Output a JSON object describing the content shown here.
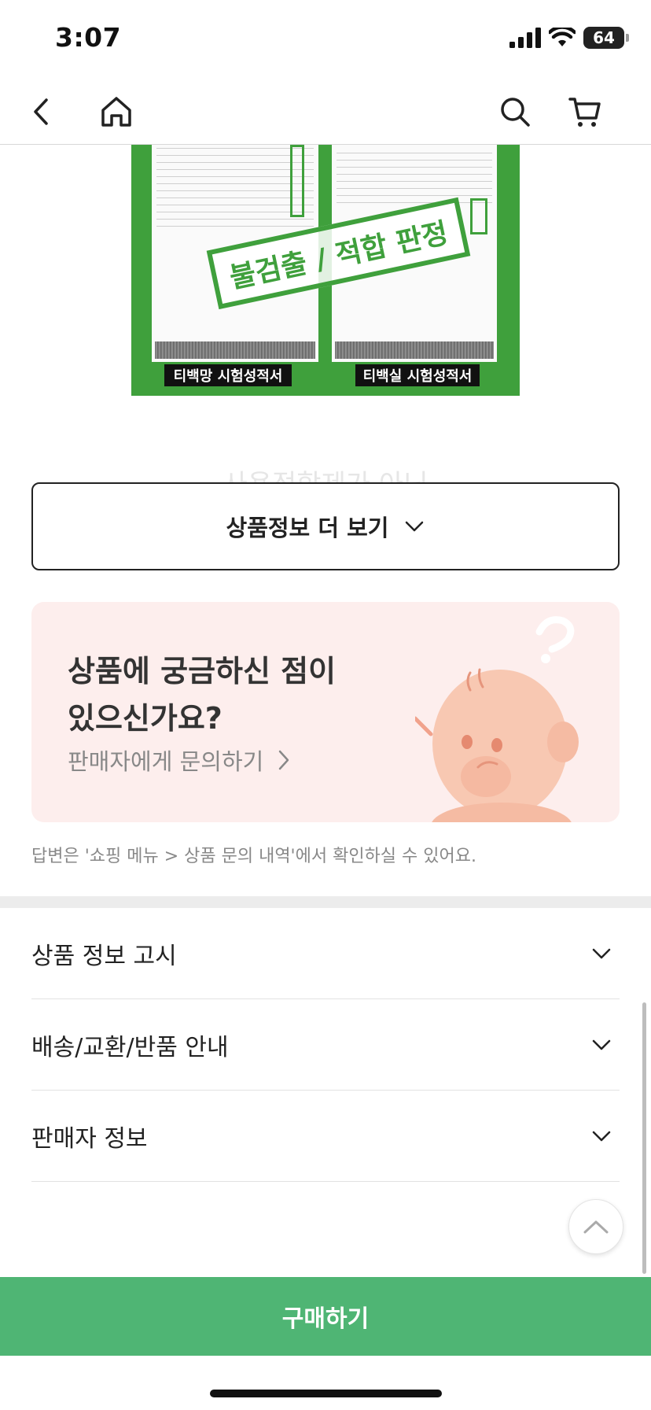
{
  "status_bar": {
    "time": "3:07",
    "battery": "64"
  },
  "nav": {
    "back_icon": "back-icon",
    "home_icon": "home-icon",
    "search_icon": "search-icon",
    "cart_icon": "cart-icon"
  },
  "certificate": {
    "left_label": "티백망 시험성적서",
    "right_label": "티백실 시험성적서",
    "verdict": "불검출 / 적합 판정"
  },
  "faded_text": "사용적합제가 아닌",
  "more_info": {
    "label": "상품정보 더 보기"
  },
  "inquiry": {
    "title_line1": "상품에 궁금하신 점이",
    "title_line2": "있으신가요?",
    "link": "판매자에게 문의하기"
  },
  "answer_note": "답변은 '쇼핑 메뉴 > 상품 문의 내역'에서 확인하실 수 있어요.",
  "accordion": [
    {
      "label": "상품 정보 고시"
    },
    {
      "label": "배송/교환/반품 안내"
    },
    {
      "label": "판매자 정보"
    }
  ],
  "buy_button": {
    "label": "구매하기"
  },
  "colors": {
    "accent_green": "#4fb574",
    "cert_green": "#3fa03c",
    "card_pink": "#fdeeed"
  }
}
